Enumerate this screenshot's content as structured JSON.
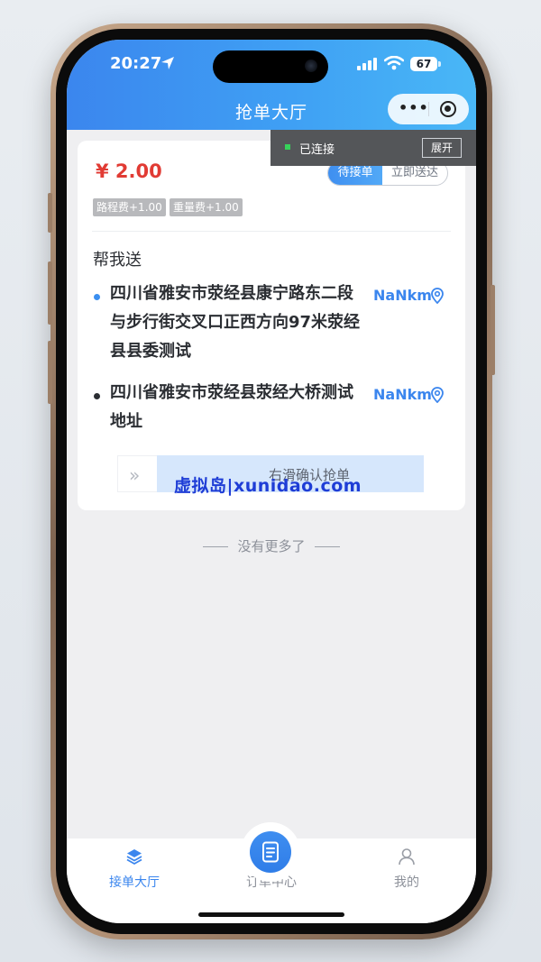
{
  "status_bar": {
    "time": "20:27",
    "battery": "67"
  },
  "nav": {
    "title": "抢单大厅"
  },
  "connection": {
    "status": "已连接",
    "expand_label": "展开"
  },
  "order": {
    "price": "¥ 2.00",
    "status_tabs": [
      "待接单",
      "立即送达"
    ],
    "fees": [
      "路程费+1.00",
      "重量费+1.00"
    ],
    "service_type": "帮我送",
    "addresses": [
      {
        "text": "四川省雅安市荥经县康宁路东二段与步行街交叉口正西方向97米荥经县县委测试",
        "distance": "NaNkm",
        "dot_color": "#3b8ff0"
      },
      {
        "text": "四川省雅安市荥经县荥经大桥测试地址",
        "distance": "NaNkm",
        "dot_color": "#2b2e33"
      }
    ],
    "slider_label": "右滑确认抢单"
  },
  "watermark": "虚拟岛|xunidao.com",
  "list_footer": "没有更多了",
  "tabbar": {
    "items": [
      {
        "label": "接单大厅",
        "icon": "layers-icon"
      },
      {
        "label": "订单中心",
        "icon": "document-icon"
      },
      {
        "label": "我的",
        "icon": "user-icon"
      }
    ]
  },
  "colors": {
    "primary": "#3b86ee",
    "price": "#e13b34",
    "active_tab": "#3b86ee",
    "inactive_tab": "#8c9099"
  }
}
